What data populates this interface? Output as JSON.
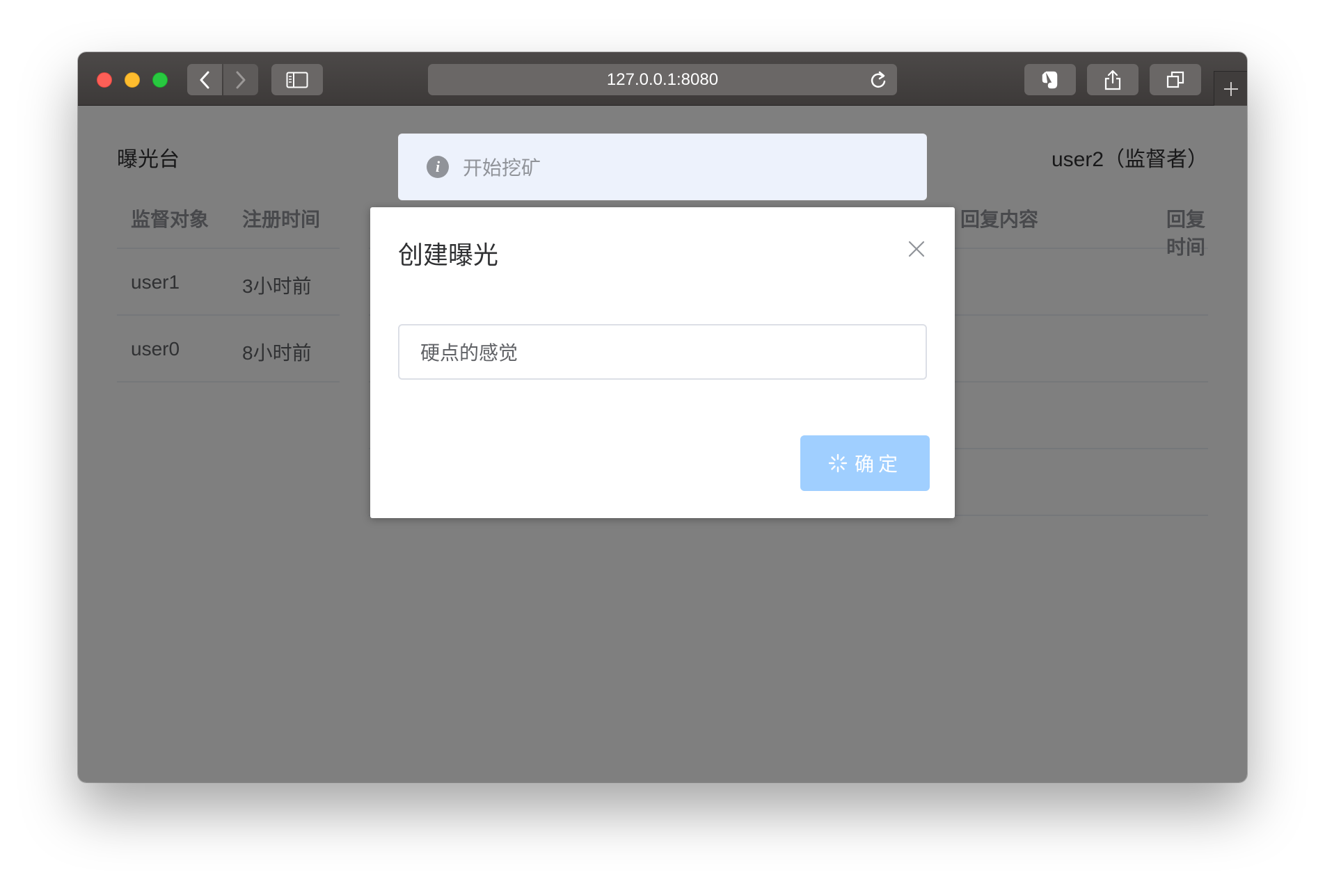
{
  "browser": {
    "url": "127.0.0.1:8080"
  },
  "page": {
    "site_title": "曝光台",
    "user_label": "user2（监督者）",
    "left_table": {
      "headers": [
        "监督对象",
        "注册时间"
      ],
      "rows": [
        [
          "user1",
          "3小时前"
        ],
        [
          "user0",
          "8小时前"
        ]
      ]
    },
    "right_table": {
      "headers": [
        "回复内容",
        "回复时间"
      ],
      "row_count": 4
    }
  },
  "message": {
    "text": "开始挖矿",
    "icon": "info-icon"
  },
  "dialog": {
    "title": "创建曝光",
    "input_value": "硬点的感觉",
    "confirm_label": "确定",
    "confirm_loading": true
  },
  "colors": {
    "primary_disabled": "#a0cfff",
    "message_bg": "#edf2fc",
    "mask": "rgba(0,0,0,0.5)"
  }
}
